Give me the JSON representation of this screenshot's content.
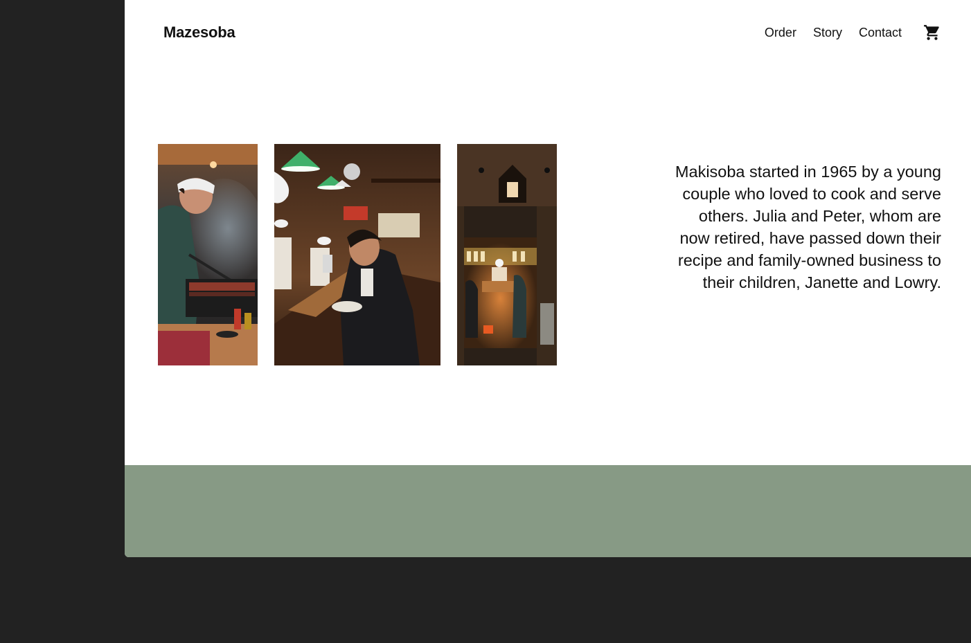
{
  "brand": {
    "name": "Mazesoba"
  },
  "nav": {
    "items": [
      "Order",
      "Story",
      "Contact"
    ]
  },
  "cart": {
    "icon": "shopping-cart-icon"
  },
  "gallery": {
    "photos": [
      {
        "subject": "cook grilling skewers"
      },
      {
        "subject": "man eating at ramen counter"
      },
      {
        "subject": "restaurant entrance at night"
      }
    ]
  },
  "story": {
    "text": "Makisoba started in 1965 by a young couple who loved to cook and serve others. Julia and Peter, whom are now retired, have passed down their recipe and family-owned business to their children, Janette and Lowry."
  },
  "colors": {
    "background": "#222222",
    "page": "#ffffff",
    "band": "#879a85",
    "text": "#111111"
  }
}
